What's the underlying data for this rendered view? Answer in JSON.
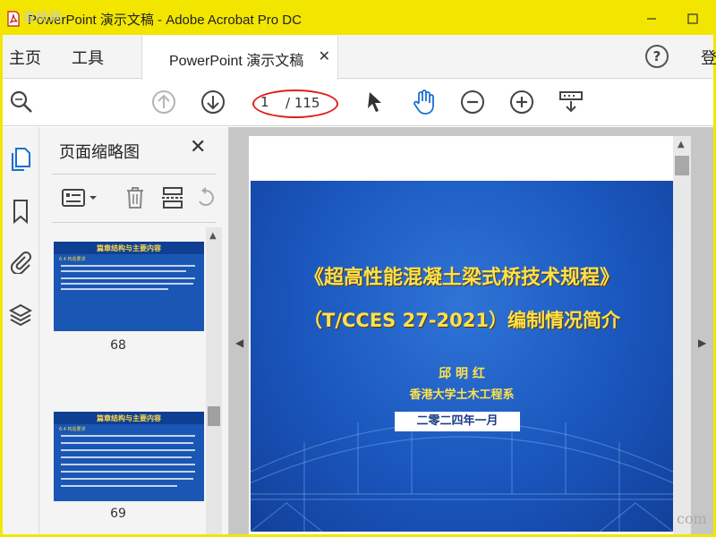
{
  "window": {
    "watermark": "道桥网",
    "title": "PowerPoint 演示文稿 - Adobe Acrobat Pro DC"
  },
  "menu": {
    "home": "主页",
    "tools": "工具",
    "doc_tab": "PowerPoint 演示文稿",
    "help": "?",
    "login": "登"
  },
  "toolbar": {
    "current_page": "1",
    "total_pages": "/ 115"
  },
  "panel": {
    "title": "页面缩略图",
    "thumbnails": [
      {
        "page": "68",
        "heading": "篇章结构与主要内容",
        "section": "6.4 构造要求"
      },
      {
        "page": "69",
        "heading": "篇章结构与主要内容",
        "section": "6.4 构造要求"
      }
    ]
  },
  "slide": {
    "title_line1": "《超高性能混凝土梁式桥技术规程》",
    "title_line2": "（T/CCES 27-2021）编制情况简介",
    "author": "邱 明 红",
    "affiliation": "香港大学土木工程系",
    "date": "二零二四年一月"
  },
  "corner_watermark": "com",
  "colors": {
    "title_bar": "#f2e600",
    "slide_blue": "#1a56bd",
    "slide_text": "#ffe14d",
    "highlight_oval": "#e0201a"
  }
}
